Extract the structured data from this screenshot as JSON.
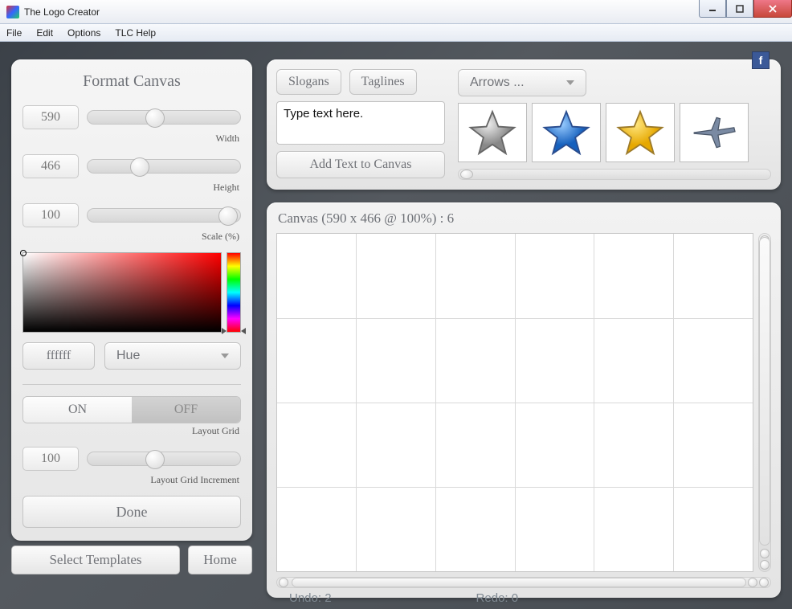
{
  "window": {
    "title": "The Logo Creator"
  },
  "menu": {
    "file": "File",
    "edit": "Edit",
    "options": "Options",
    "help": "TLC Help"
  },
  "panel": {
    "title": "Format Canvas",
    "width_label": "Width",
    "width_value": "590",
    "height_label": "Height",
    "height_value": "466",
    "scale_label": "Scale (%)",
    "scale_value": "100",
    "hex_value": "ffffff",
    "color_mode": "Hue",
    "grid_on": "ON",
    "grid_off": "OFF",
    "grid_label": "Layout Grid",
    "grid_inc_value": "100",
    "grid_inc_label": "Layout Grid Increment",
    "done": "Done"
  },
  "bottom": {
    "templates": "Select Templates",
    "home": "Home"
  },
  "top": {
    "slogans": "Slogans",
    "taglines": "Taglines",
    "text_placeholder": "Type text here.",
    "add_text": "Add Text to Canvas",
    "assets_dd": "Arrows ...",
    "assets": [
      "star-grey",
      "star-blue",
      "star-yellow",
      "plane"
    ]
  },
  "canvas": {
    "title": "Canvas (590 x 466 @ 100%) : 6"
  },
  "status": {
    "undo": "Undo: 2",
    "redo": "Redo: 0"
  },
  "social": {
    "facebook": "f"
  }
}
